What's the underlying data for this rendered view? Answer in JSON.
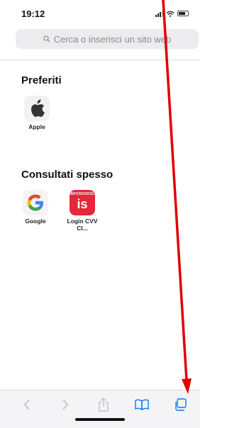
{
  "status_bar": {
    "time": "19:12"
  },
  "address_bar": {
    "placeholder": "Cerca o inserisci un sito web"
  },
  "favorites": {
    "title": "Preferiti",
    "items": [
      {
        "label": "Apple",
        "icon": "apple-logo-icon"
      }
    ]
  },
  "frequent": {
    "title": "Consultati spesso",
    "items": [
      {
        "label": "Google",
        "icon": "google-logo-icon",
        "glyph": "G"
      },
      {
        "label": "Login CVV Cl...",
        "icon": "infoschool-logo-icon",
        "top": "INFOSCHOOL",
        "glyph": "is"
      }
    ]
  },
  "toolbar": {
    "buttons": [
      "back-icon",
      "forward-icon",
      "share-icon",
      "bookmarks-icon",
      "tabs-icon"
    ]
  },
  "colors": {
    "accent": "#007aff",
    "annotation": "#e00000"
  }
}
